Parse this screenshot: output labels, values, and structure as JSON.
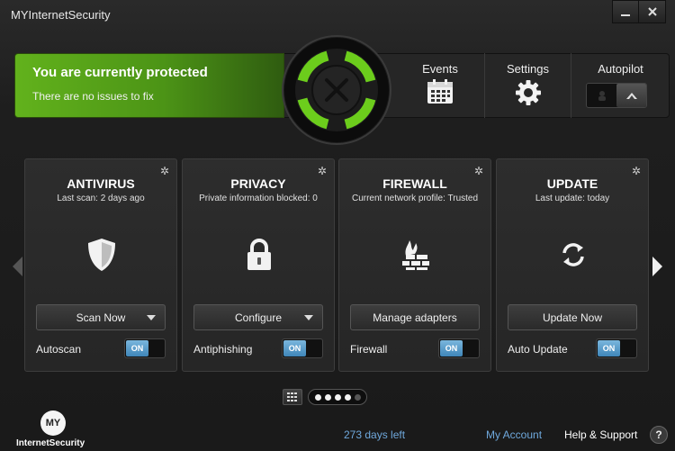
{
  "window": {
    "title": "MYInternetSecurity",
    "minimize_icon": "minimize-icon",
    "close_icon": "close-icon"
  },
  "status": {
    "title": "You are currently protected",
    "subtitle": "There are no issues to fix",
    "color": "#5aa71a"
  },
  "nav": {
    "events": {
      "label": "Events",
      "icon": "calendar-icon"
    },
    "settings": {
      "label": "Settings",
      "icon": "gear-icon"
    },
    "autopilot": {
      "label": "Autopilot",
      "icon": "autopilot-toggle"
    }
  },
  "cards": [
    {
      "title": "ANTIVIRUS",
      "subtitle": "Last scan: 2 days ago",
      "icon": "shield-icon",
      "button": "Scan Now",
      "has_dropdown": true,
      "toggle_label": "Autoscan",
      "toggle_state": "ON"
    },
    {
      "title": "PRIVACY",
      "subtitle": "Private information blocked: 0",
      "icon": "lock-icon",
      "button": "Configure",
      "has_dropdown": true,
      "toggle_label": "Antiphishing",
      "toggle_state": "ON"
    },
    {
      "title": "FIREWALL",
      "subtitle": "Current network profile: Trusted",
      "icon": "firewall-icon",
      "button": "Manage adapters",
      "has_dropdown": false,
      "toggle_label": "Firewall",
      "toggle_state": "ON"
    },
    {
      "title": "UPDATE",
      "subtitle": "Last update: today",
      "icon": "refresh-icon",
      "button": "Update Now",
      "has_dropdown": false,
      "toggle_label": "Auto Update",
      "toggle_state": "ON"
    }
  ],
  "pager": {
    "total": 5,
    "active": 4
  },
  "footer": {
    "logo_badge": "MY",
    "logo_text": "InternetSecurity",
    "days_left": "273 days left",
    "my_account": "My Account",
    "help": "Help & Support",
    "help_icon": "?"
  },
  "colors": {
    "accent_green": "#5aa71a",
    "link_blue": "#6fa8dc",
    "toggle_blue": "#4a90c2"
  }
}
